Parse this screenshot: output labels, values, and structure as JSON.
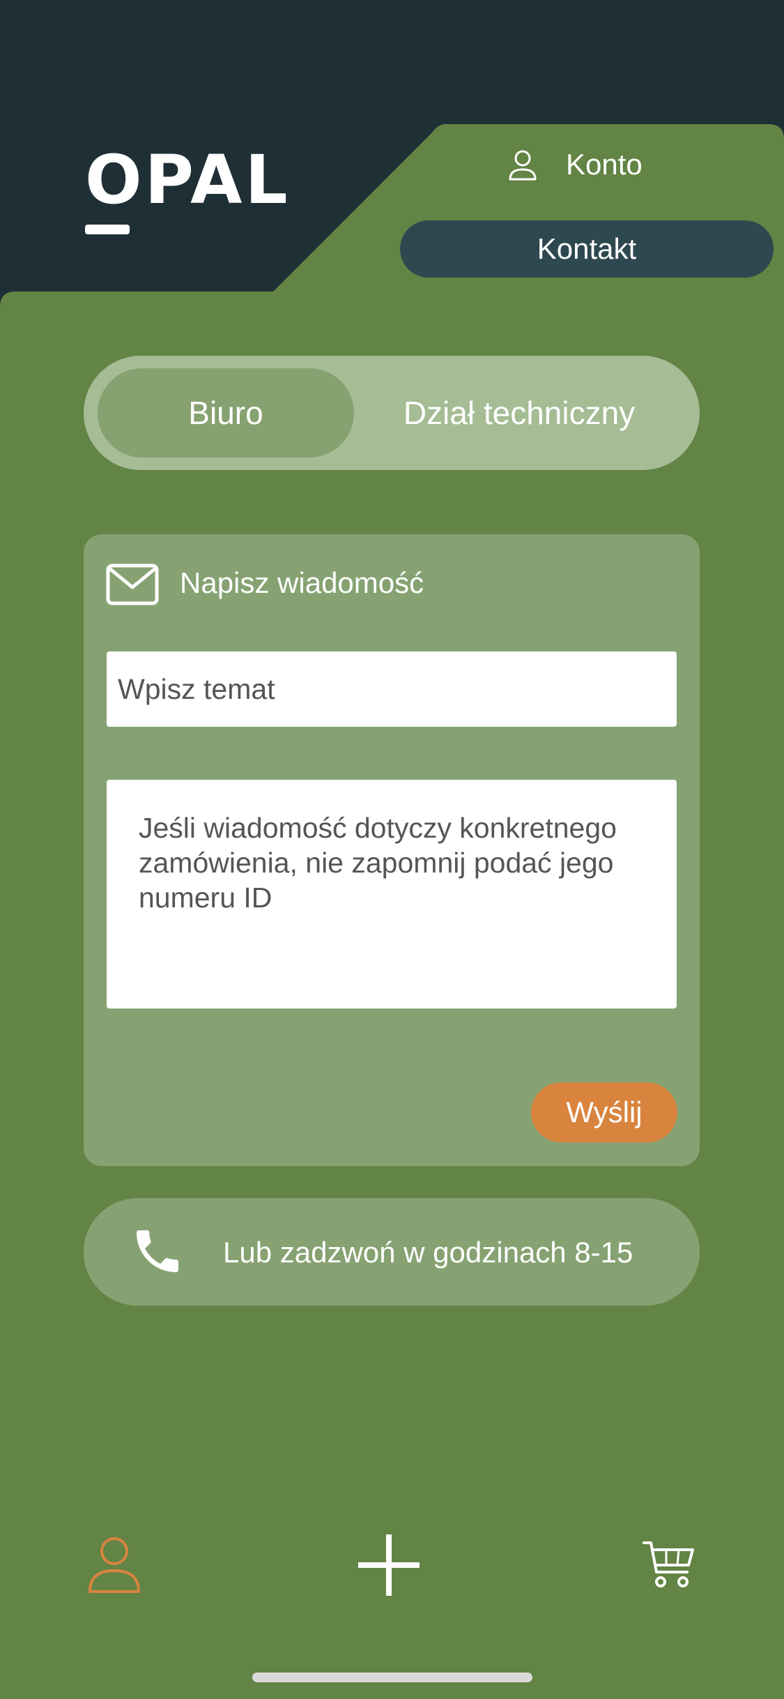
{
  "header": {
    "logo_text": "OPAL",
    "account_label": "Konto",
    "contact_label": "Kontakt"
  },
  "tabs": [
    {
      "label": "Biuro",
      "active": true
    },
    {
      "label": "Dział techniczny",
      "active": false
    }
  ],
  "message_card": {
    "title": "Napisz wiadomość",
    "subject_placeholder": "Wpisz temat",
    "message_placeholder": "Jeśli wiadomość dotyczy konkretnego zamówienia, nie zapomnij podać jego numeru ID",
    "send_label": "Wyślij"
  },
  "phone": {
    "text": "Lub zadzwoń w godzinach 8-15"
  },
  "bottom_nav": [
    {
      "icon": "user-icon",
      "active": true
    },
    {
      "icon": "plus-icon",
      "active": false
    },
    {
      "icon": "cart-icon",
      "active": false
    }
  ],
  "colors": {
    "dark": "#1f2f36",
    "green": "#628444",
    "card_green": "#86a272",
    "accent_orange": "#d9843e",
    "contact_button": "#2e4850"
  }
}
